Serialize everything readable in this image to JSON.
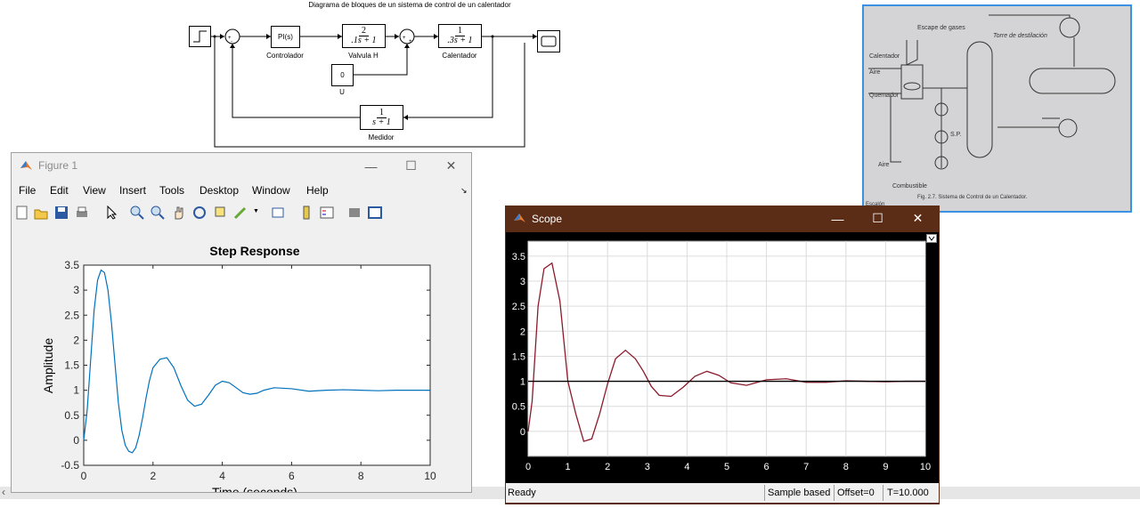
{
  "diagram": {
    "title": "Diagrama de bloques de un sistema de control de un calentador",
    "blocks": {
      "controller": {
        "content": "PI(s)",
        "label": "Controlador"
      },
      "valve": {
        "num": "2",
        "den": ".1s + 1",
        "label": "Valvula H"
      },
      "heater": {
        "num": "1",
        "den": ".3s + 1",
        "label": "Calentador"
      },
      "disturbance": {
        "content": "0",
        "label": "U"
      },
      "meter": {
        "num": "1",
        "den": "s + 1",
        "label": "Medidor"
      }
    }
  },
  "figure1": {
    "title": "Figure 1",
    "menu": [
      "File",
      "Edit",
      "View",
      "Insert",
      "Tools",
      "Desktop",
      "Window",
      "Help"
    ],
    "chart_data": {
      "type": "line",
      "title": "Step Response",
      "xlabel": "Time (seconds)",
      "ylabel": "Amplitude",
      "xlim": [
        0,
        10
      ],
      "ylim": [
        -0.5,
        3.5
      ],
      "xticks": [
        "0",
        "2",
        "4",
        "6",
        "8",
        "10"
      ],
      "yticks": [
        "-0.5",
        "0",
        "0.5",
        "1",
        "1.5",
        "2",
        "2.5",
        "3",
        "3.5"
      ],
      "grid": false,
      "series": [
        {
          "color": "#0072bd",
          "x": [
            0,
            0.1,
            0.2,
            0.3,
            0.4,
            0.5,
            0.6,
            0.7,
            0.8,
            0.9,
            1.0,
            1.1,
            1.2,
            1.3,
            1.4,
            1.5,
            1.6,
            1.7,
            1.8,
            1.9,
            2.0,
            2.2,
            2.4,
            2.6,
            2.8,
            3.0,
            3.2,
            3.4,
            3.6,
            3.8,
            4.0,
            4.2,
            4.4,
            4.6,
            4.8,
            5.0,
            5.2,
            5.5,
            6.0,
            6.5,
            7.0,
            7.5,
            8.0,
            8.5,
            9.0,
            9.5,
            10
          ],
          "y": [
            0,
            0.6,
            1.6,
            2.6,
            3.2,
            3.4,
            3.35,
            3.0,
            2.35,
            1.55,
            0.75,
            0.2,
            -0.1,
            -0.22,
            -0.25,
            -0.15,
            0.1,
            0.45,
            0.85,
            1.2,
            1.45,
            1.62,
            1.65,
            1.45,
            1.1,
            0.8,
            0.68,
            0.72,
            0.9,
            1.1,
            1.18,
            1.15,
            1.05,
            0.95,
            0.92,
            0.94,
            1.0,
            1.05,
            1.03,
            0.98,
            1.0,
            1.01,
            1.0,
            0.99,
            1.0,
            1.0,
            1.0
          ]
        }
      ]
    }
  },
  "scope": {
    "title": "Scope",
    "status": {
      "ready": "Ready",
      "mode": "Sample based",
      "offset": "Offset=0",
      "time": "T=10.000"
    },
    "chart_data": {
      "type": "line",
      "xlim": [
        0,
        10
      ],
      "ylim": [
        -0.5,
        3.8
      ],
      "xticks": [
        "0",
        "1",
        "2",
        "3",
        "4",
        "5",
        "6",
        "7",
        "8",
        "9",
        "10"
      ],
      "yticks": [
        "0",
        "0.5",
        "1",
        "1.5",
        "2",
        "2.5",
        "3",
        "3.5"
      ],
      "grid": true,
      "series": [
        {
          "color": "#8b1a2b",
          "x": [
            0,
            0.1,
            0.25,
            0.4,
            0.6,
            0.8,
            1.0,
            1.2,
            1.4,
            1.6,
            1.8,
            2.0,
            2.2,
            2.45,
            2.7,
            2.9,
            3.1,
            3.3,
            3.6,
            3.9,
            4.2,
            4.5,
            4.8,
            5.1,
            5.5,
            6.0,
            6.5,
            7.0,
            7.5,
            8.0,
            8.5,
            9.0,
            9.5,
            10
          ],
          "y": [
            0,
            0.6,
            2.5,
            3.25,
            3.36,
            2.6,
            1.0,
            0.35,
            -0.2,
            -0.15,
            0.35,
            0.95,
            1.45,
            1.62,
            1.45,
            1.2,
            0.9,
            0.72,
            0.7,
            0.88,
            1.1,
            1.2,
            1.12,
            0.97,
            0.92,
            1.03,
            1.05,
            0.98,
            0.98,
            1.01,
            1.0,
            0.99,
            1.0,
            1.0
          ]
        },
        {
          "color": "#000000",
          "x": [
            0,
            10
          ],
          "y": [
            1,
            1
          ]
        }
      ]
    }
  },
  "photo": {
    "labels": [
      "Escape de gases",
      "Torre de destilación",
      "Calentador",
      "Aire",
      "Quemador",
      "Aire",
      "Combustible",
      "S.P.",
      "Fig. 2.7. Sistema de Control de un Calentador.",
      "Escalón"
    ],
    "caption": "Fig. 2.7. Sistema de Control de un Calentador."
  }
}
